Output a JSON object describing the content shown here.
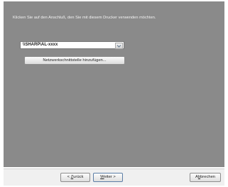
{
  "dialog": {
    "instruction": "Klicken Sie auf den Anschluß, den Sie mit diesem Drucker verwenden möchten.",
    "port_combo": {
      "selected_value": "\\\\SHARP\\AL-xxxx"
    },
    "network_button_label": "Netzwerkschnittstelle hinzufügen..."
  },
  "footer": {
    "back_button": {
      "pre": "< ",
      "accel": "Z",
      "rest": "urück"
    },
    "next_button": {
      "pre": "",
      "accel": "W",
      "rest": "eiter >"
    },
    "cancel_button": {
      "pre": "A",
      "accel": "b",
      "rest": "brechen"
    }
  },
  "icons": {
    "combo_arrow": "chevron-down-icon"
  },
  "colors": {
    "panel_background": "#8a8a8a",
    "footer_background": "#f0f0f0",
    "instruction_text": "#f4f4f4"
  }
}
